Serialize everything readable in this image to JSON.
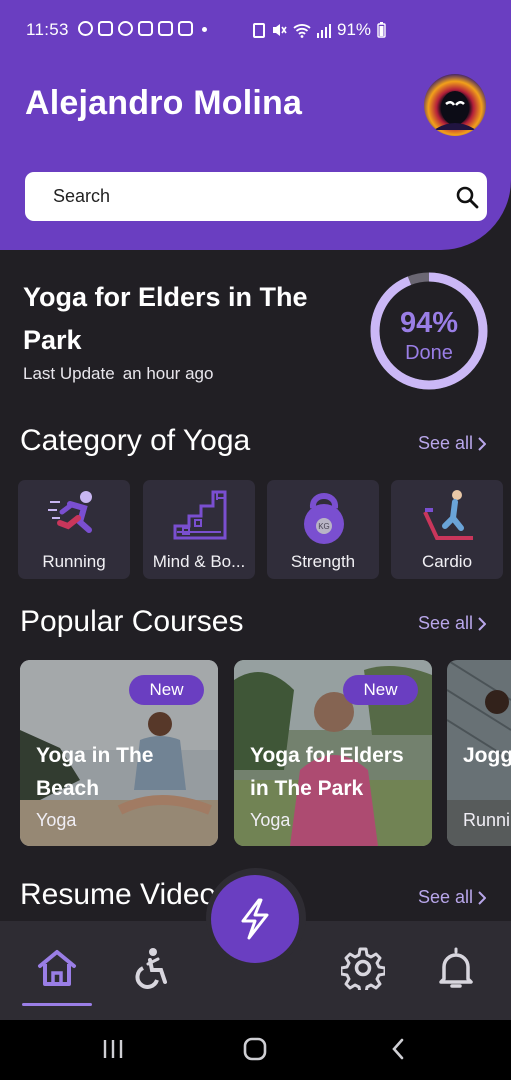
{
  "status_bar": {
    "time": "11:53",
    "battery": "91%"
  },
  "header": {
    "user_name": "Alejandro Molina",
    "search_placeholder": "Search"
  },
  "progress_card": {
    "title": "Yoga for Elders in The Park",
    "last_update_label": "Last Update",
    "last_update_value": "an hour ago",
    "percent": "94%",
    "percent_value": 94,
    "done_label": "Done"
  },
  "categories": {
    "title": "Category of Yoga",
    "see_all": "See all",
    "items": [
      {
        "label": "Running",
        "icon": "running-icon"
      },
      {
        "label": "Mind & Bo...",
        "icon": "stairs-icon"
      },
      {
        "label": "Strength",
        "icon": "kettlebell-icon"
      },
      {
        "label": "Cardio",
        "icon": "treadmill-icon"
      }
    ]
  },
  "popular_courses": {
    "title": "Popular Courses",
    "see_all": "See all",
    "items": [
      {
        "name": "Yoga in The Beach",
        "category": "Yoga",
        "badge": "New"
      },
      {
        "name": "Yoga for Elders in The Park",
        "category": "Yoga",
        "badge": "New"
      },
      {
        "name": "Jogg Park",
        "category": "Runni"
      }
    ]
  },
  "resume_videos": {
    "title": "Resume Videos",
    "see_all": "See all"
  },
  "colors": {
    "brand": "#6a3ec1",
    "accent": "#9a7ee6",
    "background": "#211f24",
    "card": "#302d3a"
  },
  "bottom_nav": [
    "home-icon",
    "accessibility-icon",
    "lightning-icon",
    "settings-icon",
    "bell-icon"
  ]
}
